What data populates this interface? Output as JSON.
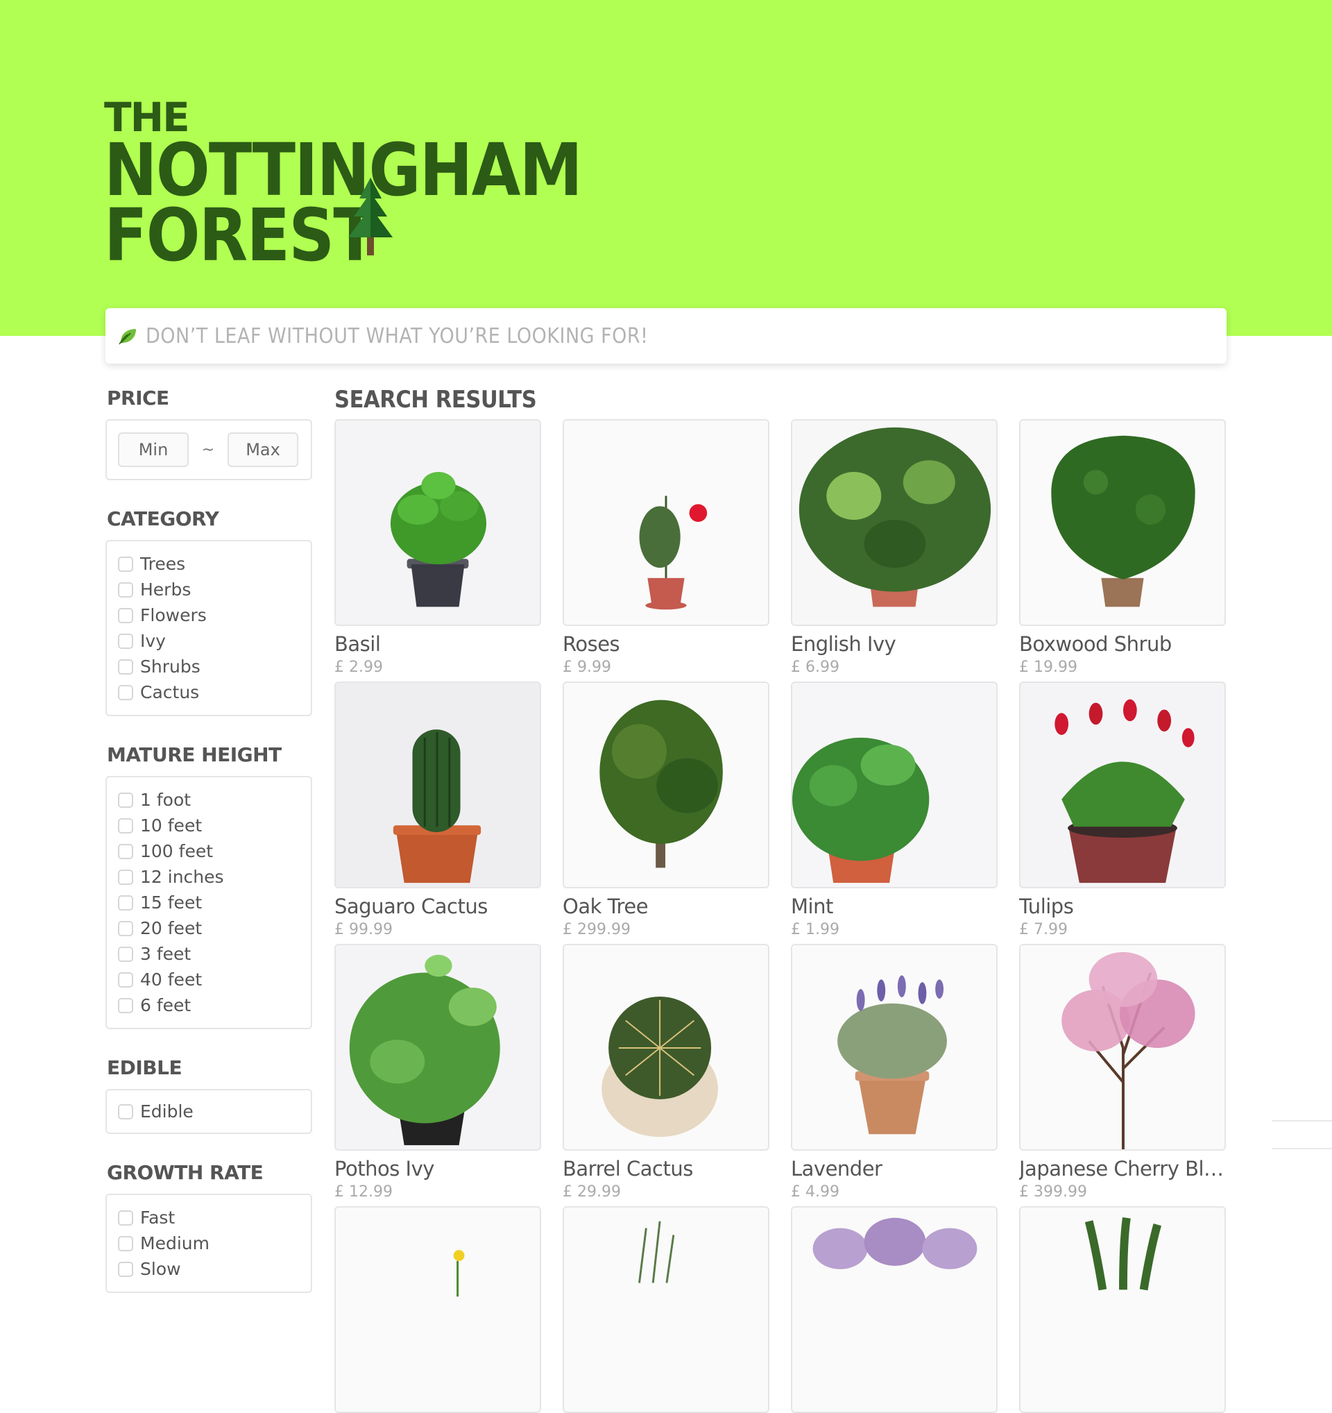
{
  "brand": {
    "line1": "THE",
    "line2": "NOTTINGHAM",
    "line3": "FOREST"
  },
  "search": {
    "placeholder": "DON’T LEAF WITHOUT WHAT YOU’RE LOOKING FOR!"
  },
  "filters": {
    "price": {
      "title": "PRICE",
      "min_placeholder": "Min",
      "separator": "~",
      "max_placeholder": "Max"
    },
    "category": {
      "title": "CATEGORY",
      "options": [
        "Trees",
        "Herbs",
        "Flowers",
        "Ivy",
        "Shrubs",
        "Cactus"
      ]
    },
    "mature_height": {
      "title": "MATURE HEIGHT",
      "options": [
        "1 foot",
        "10 feet",
        "100 feet",
        "12 inches",
        "15 feet",
        "20 feet",
        "3 feet",
        "40 feet",
        "6 feet"
      ]
    },
    "edible": {
      "title": "EDIBLE",
      "options": [
        "Edible"
      ]
    },
    "growth_rate": {
      "title": "GROWTH RATE",
      "options": [
        "Fast",
        "Medium",
        "Slow"
      ]
    }
  },
  "results": {
    "title": "SEARCH RESULTS",
    "products": [
      {
        "name": "Basil",
        "price": "£ 2.99",
        "icon": "basil-plant-photo"
      },
      {
        "name": "Roses",
        "price": "£ 9.99",
        "icon": "rose-plant-photo"
      },
      {
        "name": "English Ivy",
        "price": "£ 6.99",
        "icon": "ivy-plant-photo"
      },
      {
        "name": "Boxwood Shrub",
        "price": "£ 19.99",
        "icon": "boxwood-photo"
      },
      {
        "name": "Saguaro Cactus",
        "price": "£ 99.99",
        "icon": "saguaro-photo"
      },
      {
        "name": "Oak Tree",
        "price": "£ 299.99",
        "icon": "oak-tree-photo"
      },
      {
        "name": "Mint",
        "price": "£ 1.99",
        "icon": "mint-plant-photo"
      },
      {
        "name": "Tulips",
        "price": "£ 7.99",
        "icon": "tulips-photo"
      },
      {
        "name": "Pothos Ivy",
        "price": "£ 12.99",
        "icon": "pothos-photo"
      },
      {
        "name": "Barrel Cactus",
        "price": "£ 29.99",
        "icon": "barrel-cactus-photo"
      },
      {
        "name": "Lavender",
        "price": "£ 4.99",
        "icon": "lavender-photo"
      },
      {
        "name": "Japanese Cherry Blos...",
        "price": "£ 399.99",
        "icon": "cherry-blossom-photo"
      },
      {
        "name": "",
        "price": "",
        "icon": "daffodil-photo"
      },
      {
        "name": "",
        "price": "",
        "icon": "rosemary-photo"
      },
      {
        "name": "",
        "price": "",
        "icon": "lilac-photo"
      },
      {
        "name": "",
        "price": "",
        "icon": "snake-plant-photo"
      }
    ]
  },
  "colors": {
    "brand_green": "#b1ff52",
    "logo_green": "#2c5b16",
    "text_gray": "#555555",
    "muted_gray": "#aaaaaa"
  }
}
